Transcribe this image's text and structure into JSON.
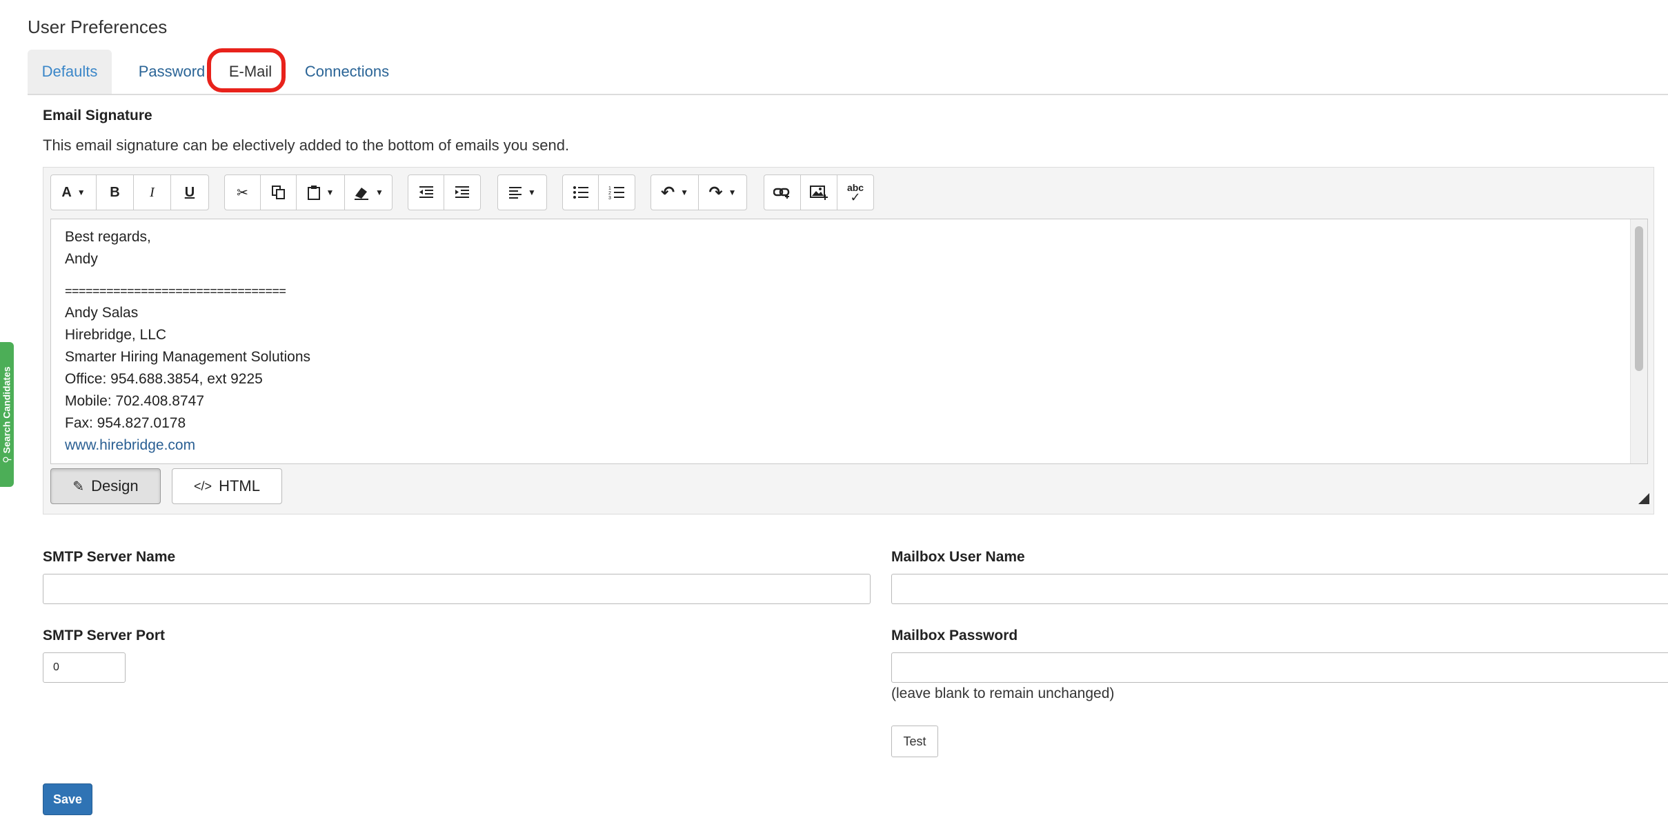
{
  "page": {
    "title": "User Preferences"
  },
  "tabs": [
    {
      "label": "Defaults"
    },
    {
      "label": "Password"
    },
    {
      "label": "E-Mail"
    },
    {
      "label": "Connections"
    }
  ],
  "signature": {
    "heading": "Email Signature",
    "description": "This email signature can be electively added to the bottom of emails you send.",
    "toolbar": {
      "font_label": "A",
      "bold": "B",
      "italic": "I",
      "underline": "U",
      "spellcheck_label": "abc"
    },
    "content": {
      "line1": "Best regards,",
      "line2": "Andy",
      "separator": "================================",
      "name": "Andy Salas",
      "company": "Hirebridge, LLC",
      "tagline": "Smarter Hiring Management Solutions",
      "office": "Office: 954.688.3854, ext 9225",
      "mobile": "Mobile: 702.408.8747",
      "fax": "Fax: 954.827.0178",
      "website": "www.hirebridge.com"
    },
    "modes": {
      "design": "Design",
      "html": "HTML"
    }
  },
  "form": {
    "smtp_server_name_label": "SMTP Server Name",
    "smtp_server_name_value": "",
    "smtp_server_port_label": "SMTP Server Port",
    "smtp_server_port_value": "0",
    "mailbox_user_label": "Mailbox User Name",
    "mailbox_user_value": "",
    "mailbox_password_label": "Mailbox Password",
    "mailbox_password_value": "",
    "password_hint": "(leave blank to remain unchanged)",
    "test_button": "Test",
    "save_button": "Save"
  },
  "side_tab": {
    "label": "Search Candidates"
  },
  "colors": {
    "accent": "#2f73b4",
    "highlight": "#e8221b",
    "side_tab": "#4cae57"
  }
}
